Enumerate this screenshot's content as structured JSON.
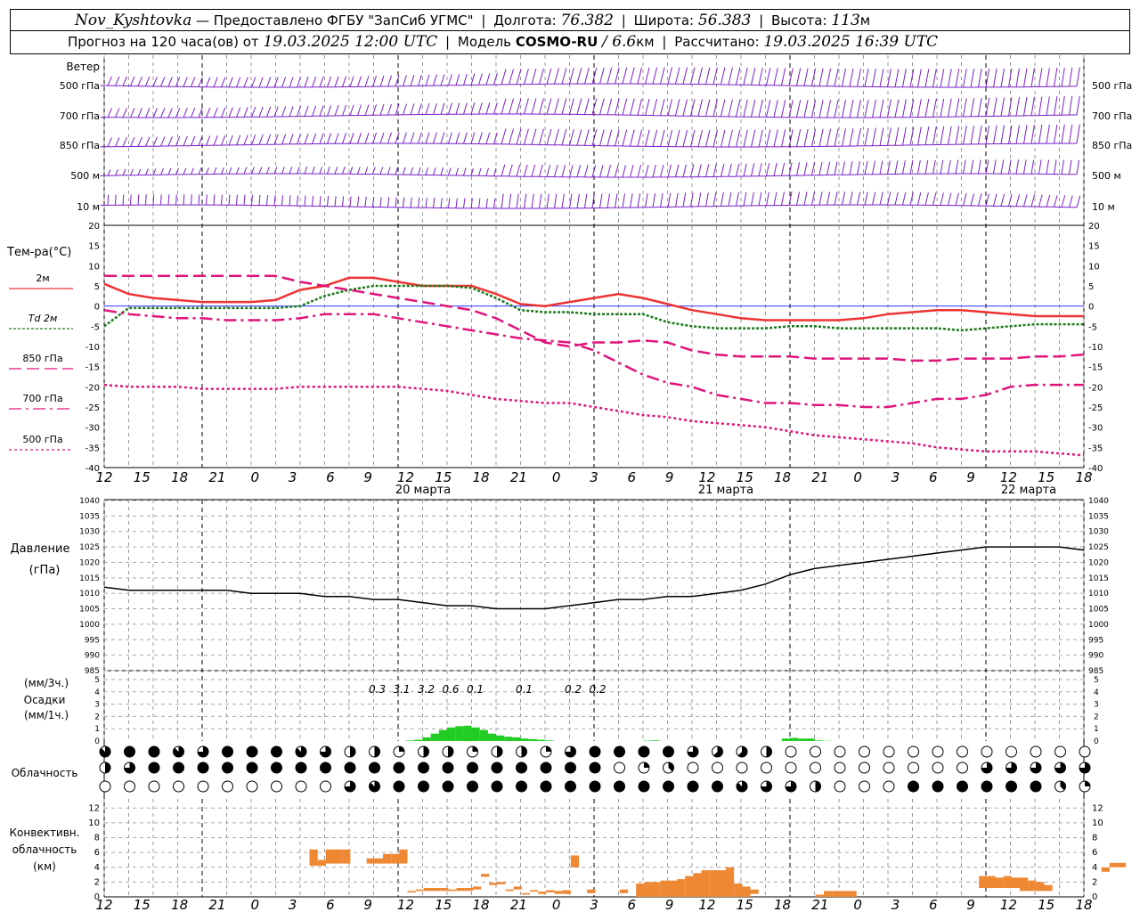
{
  "header": {
    "station": "Nov_Kyshtovka",
    "provider_text": "— Предоставлено ФГБУ \"ЗапСиб УГМС\"",
    "lon_label": "Долгота:",
    "lon_value": "76.382",
    "lat_label": "Широта:",
    "lat_value": "56.383",
    "alt_label": "Высота:",
    "alt_value": "113",
    "alt_unit": "м",
    "forecast_label": "Прогноз на 120 часа(ов) от",
    "forecast_time": "19.03.2025 12:00 UTC",
    "model_label": "Модель",
    "model_name": "COSMO-RU",
    "model_res": "/ 6.6",
    "model_res_unit": "км",
    "calc_label": "Рассчитано:",
    "calc_time": "19.03.2025 16:39 UTC"
  },
  "time_axis": {
    "hour_labels": [
      "12",
      "15",
      "18",
      "21",
      "0",
      "3",
      "6",
      "9",
      "12",
      "15",
      "18",
      "21",
      "0",
      "3",
      "6",
      "9",
      "12",
      "15",
      "18",
      "21",
      "0",
      "3",
      "6",
      "9",
      "12",
      "15",
      "18"
    ],
    "date_labels": [
      "20 марта",
      "21 марта",
      "22 марта"
    ]
  },
  "wind": {
    "title": "Ветер",
    "levels": [
      "500 гПа",
      "700 гПа",
      "850 гПа",
      "500 м",
      "10  м"
    ],
    "color": "#7a1fc8"
  },
  "colors": {
    "t2m": "#ee3333",
    "td2m": "#1a7a1a",
    "temp_pink": "#e0147a",
    "pressure": "#000000",
    "precip": "#22cc22",
    "convective": "#ee8833",
    "zero_line": "#3333ff"
  },
  "chart_data": [
    {
      "type": "line",
      "title": "Тем-ра(°C)",
      "ylim": [
        -40,
        20
      ],
      "yticks": [
        "20",
        "15",
        "10",
        "5",
        "0",
        "-5",
        "-10",
        "-15",
        "-20",
        "-25",
        "-30",
        "-35",
        "-40"
      ],
      "x_hours": [
        0,
        3,
        6,
        9,
        12,
        15,
        18,
        21,
        24,
        27,
        30,
        33,
        36,
        39,
        42,
        45,
        48,
        51,
        54,
        57,
        60,
        63,
        66,
        69,
        72,
        75,
        78,
        81,
        84,
        87,
        90,
        93,
        96,
        99,
        102,
        105,
        108,
        111,
        114,
        117,
        120
      ],
      "series": [
        {
          "name": "2м",
          "values": [
            5.5,
            3,
            2,
            1.5,
            1,
            1,
            1,
            1.5,
            4,
            5,
            7,
            7,
            6,
            5,
            5,
            5,
            3,
            0.5,
            0,
            1,
            2,
            3,
            2,
            0.5,
            -1,
            -2,
            -3,
            -3.5,
            -3.5,
            -3.5,
            -3.5,
            -3,
            -2,
            -1.5,
            -1,
            -1,
            -1.5,
            -2,
            -2.5,
            -2.5,
            -2.5
          ]
        },
        {
          "name": "Td 2м",
          "values": [
            -5,
            -0.5,
            -0.5,
            -0.5,
            -0.5,
            -0.5,
            -0.5,
            -0.5,
            0,
            2.5,
            4,
            5,
            5,
            5,
            5,
            4.5,
            2,
            -1,
            -1.5,
            -1.5,
            -2,
            -2,
            -2,
            -4,
            -5,
            -5.5,
            -5.5,
            -5.5,
            -5,
            -5,
            -5.5,
            -5.5,
            -5.5,
            -5.5,
            -5.5,
            -6,
            -5.5,
            -5,
            -4.5,
            -4.5,
            -4.5
          ]
        },
        {
          "name": "850 гПа",
          "values": [
            7.5,
            7.5,
            7.5,
            7.5,
            7.5,
            7.5,
            7.5,
            7.5,
            6,
            5,
            4,
            3,
            2,
            1,
            0,
            -1,
            -3,
            -6,
            -9,
            -10,
            -9,
            -9,
            -8.5,
            -9,
            -11,
            -12,
            -12.5,
            -12.5,
            -12.5,
            -13,
            -13,
            -13,
            -13,
            -13.5,
            -13.5,
            -13,
            -13,
            -13,
            -12.5,
            -12.5,
            -12
          ]
        },
        {
          "name": "700 гПа",
          "values": [
            -1,
            -2,
            -2.5,
            -3,
            -3,
            -3.5,
            -3.5,
            -3.5,
            -3,
            -2,
            -2,
            -2,
            -3,
            -4,
            -5,
            -6,
            -7,
            -8,
            -8.5,
            -9,
            -11,
            -14,
            -17,
            -19,
            -20,
            -22,
            -23,
            -24,
            -24,
            -24.5,
            -24.5,
            -25,
            -25,
            -24,
            -23,
            -23,
            -22,
            -20,
            -19.5,
            -19.5,
            -19.5
          ]
        },
        {
          "name": "500 гПа",
          "values": [
            -19.5,
            -20,
            -20,
            -20,
            -20.5,
            -20.5,
            -20.5,
            -20.5,
            -20,
            -20,
            -20,
            -20,
            -20,
            -20.5,
            -21,
            -22,
            -23,
            -23.5,
            -24,
            -24,
            -25,
            -26,
            -27,
            -27.5,
            -28.5,
            -29,
            -29.5,
            -30,
            -31,
            -32,
            -32.5,
            -33,
            -33.5,
            -34,
            -35,
            -35.5,
            -36,
            -36,
            -36,
            -36.5,
            -37
          ]
        }
      ]
    },
    {
      "type": "line",
      "title": "Давление",
      "ylabel": "(гПа)",
      "ylim": [
        985,
        1040
      ],
      "yticks": [
        "1040",
        "1035",
        "1030",
        "1025",
        "1020",
        "1015",
        "1010",
        "1005",
        "1000",
        "995",
        "990",
        "985"
      ],
      "x_hours": [
        0,
        3,
        6,
        9,
        12,
        15,
        18,
        21,
        24,
        27,
        30,
        33,
        36,
        39,
        42,
        45,
        48,
        51,
        54,
        57,
        60,
        63,
        66,
        69,
        72,
        75,
        78,
        81,
        84,
        87,
        90,
        93,
        96,
        99,
        102,
        105,
        108,
        111,
        114,
        117,
        120
      ],
      "series": [
        {
          "name": "Давление",
          "values": [
            1012,
            1011,
            1011,
            1011,
            1011,
            1011,
            1010,
            1010,
            1010,
            1009,
            1009,
            1008,
            1008,
            1007,
            1006,
            1006,
            1005,
            1005,
            1005,
            1006,
            1007,
            1008,
            1008,
            1009,
            1009,
            1010,
            1011,
            1013,
            1016,
            1018,
            1019,
            1020,
            1021,
            1022,
            1023,
            1024,
            1025,
            1025,
            1025,
            1025,
            1024
          ]
        }
      ]
    },
    {
      "type": "bar",
      "title": "Осадки",
      "ylabel": "(мм/1ч.)",
      "ylabel_top": "(мм/3ч.)",
      "ylim": [
        0,
        5
      ],
      "yticks": [
        "5",
        "4",
        "3",
        "2",
        "1",
        "0"
      ],
      "hourly_start_hour": 24,
      "hourly_values": [
        0,
        0,
        0,
        0,
        0,
        0,
        0,
        0,
        0,
        0,
        0,
        0,
        0,
        0.05,
        0.1,
        0.3,
        0.6,
        0.9,
        1.1,
        1.2,
        1.25,
        1.1,
        0.9,
        0.6,
        0.45,
        0.35,
        0.3,
        0.2,
        0.15,
        0.1,
        0.05,
        0,
        0,
        0,
        0,
        0,
        0,
        0,
        0,
        0,
        0,
        0,
        0.03,
        0.05,
        0,
        0,
        0,
        0,
        0,
        0,
        0,
        0,
        0,
        0,
        0,
        0,
        0,
        0,
        0,
        0.2,
        0.25,
        0.2,
        0.2,
        0.05,
        0.02
      ],
      "three_hour_totals": [
        {
          "hour": 33,
          "label": "0.3"
        },
        {
          "hour": 36,
          "label": "3.1"
        },
        {
          "hour": 39,
          "label": "3.2"
        },
        {
          "hour": 42,
          "label": "0.6"
        },
        {
          "hour": 45,
          "label": "0.1"
        },
        {
          "hour": 51,
          "label": "0.1"
        },
        {
          "hour": 57,
          "label": "0.2"
        },
        {
          "hour": 60,
          "label": "0.2"
        }
      ]
    },
    {
      "type": "table",
      "title": "Облачность",
      "note": "cloud cover symbols per hour for three layers; values are oktas 0..8 sampled every 3 hours",
      "rows": [
        {
          "name": "high",
          "values": [
            7,
            8,
            8,
            7,
            6,
            8,
            8,
            8,
            7,
            6,
            4,
            4,
            2,
            4,
            4,
            2,
            4,
            4,
            2,
            6,
            8,
            8,
            8,
            8,
            6,
            5,
            5,
            4,
            0,
            0,
            0,
            0,
            0,
            0,
            0,
            0,
            0,
            0,
            0,
            0,
            0
          ]
        },
        {
          "name": "middle",
          "values": [
            4,
            6,
            8,
            8,
            8,
            8,
            8,
            8,
            8,
            8,
            8,
            8,
            8,
            8,
            8,
            8,
            8,
            8,
            8,
            8,
            8,
            0,
            2,
            3,
            0,
            0,
            0,
            0,
            0,
            0,
            0,
            0,
            0,
            0,
            0,
            0,
            6,
            6,
            6,
            6,
            6
          ]
        },
        {
          "name": "low",
          "values": [
            0,
            0,
            0,
            0,
            0,
            0,
            0,
            0,
            0,
            0,
            6,
            7,
            8,
            8,
            8,
            8,
            8,
            8,
            8,
            8,
            8,
            8,
            8,
            8,
            8,
            8,
            7,
            6,
            6,
            4,
            0,
            0,
            0,
            8,
            8,
            8,
            8,
            8,
            8,
            3,
            2
          ]
        }
      ]
    },
    {
      "type": "bar",
      "title": "Конвективн.",
      "title2": "облачность",
      "ylabel": "(км)",
      "ylim": [
        0,
        13
      ],
      "yticks": [
        "12",
        "10",
        "8",
        "6",
        "4",
        "2",
        "0"
      ],
      "note": "floating bars: base and top in km, by forecast hour",
      "bars": [
        {
          "hour": 9,
          "bottom": 4.2,
          "top": 6.4
        },
        {
          "hour": 10,
          "bottom": 4.2,
          "top": 5.0
        },
        {
          "hour": 11,
          "bottom": 4.5,
          "top": 6.4
        },
        {
          "hour": 12,
          "bottom": 4.5,
          "top": 6.4
        },
        {
          "hour": 13,
          "bottom": 4.5,
          "top": 6.4
        },
        {
          "hour": 16,
          "bottom": 4.5,
          "top": 5.2
        },
        {
          "hour": 17,
          "bottom": 4.5,
          "top": 5.2
        },
        {
          "hour": 18,
          "bottom": 4.5,
          "top": 5.8
        },
        {
          "hour": 19,
          "bottom": 4.5,
          "top": 5.8
        },
        {
          "hour": 20,
          "bottom": 4.5,
          "top": 6.4
        },
        {
          "hour": 21,
          "bottom": 0.6,
          "top": 0.8
        },
        {
          "hour": 22,
          "bottom": 0.8,
          "top": 1.0
        },
        {
          "hour": 23,
          "bottom": 0.8,
          "top": 1.2
        },
        {
          "hour": 24,
          "bottom": 0.8,
          "top": 1.2
        },
        {
          "hour": 25,
          "bottom": 0.8,
          "top": 1.2
        },
        {
          "hour": 26,
          "bottom": 0.8,
          "top": 1.0
        },
        {
          "hour": 27,
          "bottom": 0.8,
          "top": 1.2
        },
        {
          "hour": 28,
          "bottom": 0.8,
          "top": 1.2
        },
        {
          "hour": 29,
          "bottom": 1.0,
          "top": 1.4
        },
        {
          "hour": 30,
          "bottom": 2.7,
          "top": 3.1
        },
        {
          "hour": 31,
          "bottom": 1.6,
          "top": 1.9
        },
        {
          "hour": 32,
          "bottom": 1.7,
          "top": 2.0
        },
        {
          "hour": 33,
          "bottom": 0.8,
          "top": 1.0
        },
        {
          "hour": 34,
          "bottom": 1.0,
          "top": 1.4
        },
        {
          "hour": 35,
          "bottom": 0.3,
          "top": 0.5
        },
        {
          "hour": 36,
          "bottom": 0.7,
          "top": 0.9
        },
        {
          "hour": 37,
          "bottom": 0.4,
          "top": 0.7
        },
        {
          "hour": 38,
          "bottom": 0.6,
          "top": 0.9
        },
        {
          "hour": 39,
          "bottom": 0.4,
          "top": 0.8
        },
        {
          "hour": 40,
          "bottom": 0.4,
          "top": 0.9
        },
        {
          "hour": 41,
          "bottom": 4.0,
          "top": 5.6
        },
        {
          "hour": 43,
          "bottom": 0.5,
          "top": 1.0
        },
        {
          "hour": 47,
          "bottom": 0.5,
          "top": 1.0
        },
        {
          "hour": 49,
          "bottom": 0.0,
          "top": 1.8
        },
        {
          "hour": 50,
          "bottom": 0.0,
          "top": 2.0
        },
        {
          "hour": 51,
          "bottom": 0.0,
          "top": 2.0
        },
        {
          "hour": 52,
          "bottom": 0.0,
          "top": 2.2
        },
        {
          "hour": 53,
          "bottom": 0.0,
          "top": 2.2
        },
        {
          "hour": 54,
          "bottom": 0.0,
          "top": 2.4
        },
        {
          "hour": 55,
          "bottom": 0.0,
          "top": 2.8
        },
        {
          "hour": 56,
          "bottom": 0.0,
          "top": 3.2
        },
        {
          "hour": 57,
          "bottom": 0.0,
          "top": 3.6
        },
        {
          "hour": 58,
          "bottom": 0.0,
          "top": 3.6
        },
        {
          "hour": 59,
          "bottom": 0.0,
          "top": 3.6
        },
        {
          "hour": 60,
          "bottom": 0.0,
          "top": 4.0
        },
        {
          "hour": 61,
          "bottom": 0.0,
          "top": 1.8
        },
        {
          "hour": 62,
          "bottom": 0.0,
          "top": 1.4
        },
        {
          "hour": 63,
          "bottom": 0.4,
          "top": 1.0
        },
        {
          "hour": 71,
          "bottom": 0.0,
          "top": 0.3
        },
        {
          "hour": 72,
          "bottom": 0.0,
          "top": 0.8
        },
        {
          "hour": 73,
          "bottom": 0.0,
          "top": 0.8
        },
        {
          "hour": 74,
          "bottom": 0.0,
          "top": 0.8
        },
        {
          "hour": 75,
          "bottom": 0.0,
          "top": 0.8
        },
        {
          "hour": 91,
          "bottom": 1.2,
          "top": 2.8
        },
        {
          "hour": 92,
          "bottom": 1.2,
          "top": 2.8
        },
        {
          "hour": 93,
          "bottom": 1.2,
          "top": 2.6
        },
        {
          "hour": 94,
          "bottom": 1.2,
          "top": 2.8
        },
        {
          "hour": 95,
          "bottom": 1.2,
          "top": 2.6
        },
        {
          "hour": 96,
          "bottom": 0.8,
          "top": 2.6
        },
        {
          "hour": 97,
          "bottom": 0.8,
          "top": 2.2
        },
        {
          "hour": 98,
          "bottom": 0.8,
          "top": 2.0
        },
        {
          "hour": 99,
          "bottom": 0.8,
          "top": 1.6
        },
        {
          "hour": 106,
          "bottom": 3.4,
          "top": 4.0
        },
        {
          "hour": 107,
          "bottom": 4.0,
          "top": 4.6
        },
        {
          "hour": 108,
          "bottom": 4.0,
          "top": 4.6
        }
      ]
    }
  ],
  "temp_legend": [
    "2м",
    "Td  2м",
    "850 гПа",
    "700 гПа",
    "500 гПа"
  ],
  "pressure_labels": {
    "title": "Давление",
    "unit": "(гПа)"
  },
  "precip_labels": {
    "top": "(мм/3ч.)",
    "title": "Осадки",
    "unit": "(мм/1ч.)"
  },
  "cloud_label": "Облачность",
  "conv_labels": {
    "l1": "Конвективн.",
    "l2": "облачность",
    "l3": "(км)"
  }
}
